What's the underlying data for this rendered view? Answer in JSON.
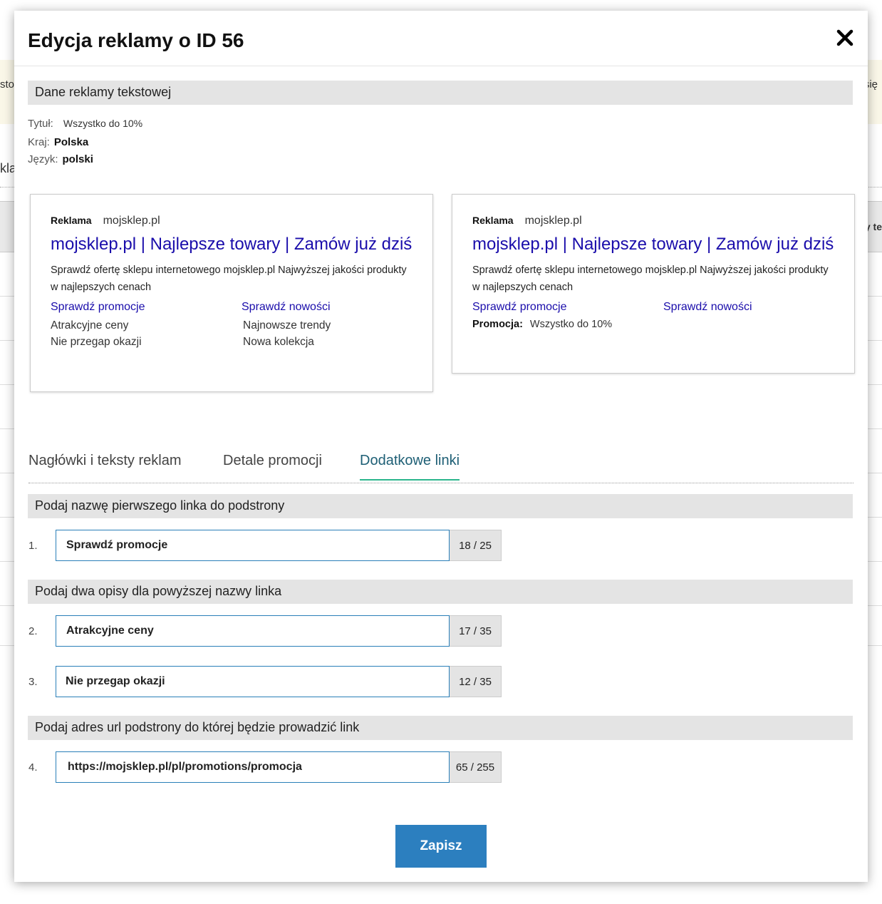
{
  "background": {
    "fragment_left_top": "sto",
    "fragment_right_top": "się",
    "fragment_left_mid": "kla",
    "fragment_right_header": "y te"
  },
  "modal": {
    "title": "Edycja reklamy o ID 56",
    "close_icon": "close-icon"
  },
  "ad_data": {
    "section_title": "Dane reklamy tekstowej",
    "title_label": "Tytuł:",
    "title_value": "Wszystko do 10%",
    "country_label": "Kraj:",
    "country_value": "Polska",
    "language_label": "Język:",
    "language_value": "polski"
  },
  "previews": [
    {
      "badge": "Reklama",
      "domain": "mojsklep.pl",
      "headline": "mojsklep.pl | Najlepsze towary  | Zamów już dziś",
      "description": "Sprawdź ofertę sklepu internetowego mojsklep.pl  Najwyższej jakości produkty w najlepszych cenach",
      "link_a": "Sprawdź promocje",
      "link_b": "Sprawdź nowości",
      "link_a_desc1": "Atrakcyjne ceny",
      "link_a_desc2": "Nie przegap okazji",
      "link_b_desc1": "Najnowsze trendy",
      "link_b_desc2": "Nowa kolekcja"
    },
    {
      "badge": "Reklama",
      "domain": "mojsklep.pl",
      "headline": "mojsklep.pl | Najlepsze towary  | Zamów już dziś",
      "description": "Sprawdź ofertę sklepu internetowego mojsklep.pl  Najwyższej jakości produkty w najlepszych cenach",
      "link_a": "Sprawdź promocje",
      "link_b": "Sprawdź nowości",
      "promo_label": "Promocja:",
      "promo_value": "Wszystko do 10%"
    }
  ],
  "tabs": [
    {
      "label": "Nagłówki i teksty reklam",
      "active": false
    },
    {
      "label": "Detale promocji",
      "active": false
    },
    {
      "label": "Dodatkowe linki",
      "active": true
    }
  ],
  "form": {
    "section1": "Podaj nazwę pierwszego linka do podstrony",
    "section2": "Podaj dwa opisy dla powyższej nazwy linka",
    "section3": "Podaj adres url podstrony do której będzie prowadzić link",
    "fields": [
      {
        "num": "1.",
        "value": "Sprawdź promocje",
        "counter": "18 / 25"
      },
      {
        "num": "2.",
        "value": "Atrakcyjne ceny",
        "counter": "17 / 35"
      },
      {
        "num": "3.",
        "value": "Nie przegap okazji",
        "counter": "12 / 35"
      },
      {
        "num": "4.",
        "value": "https://mojsklep.pl/pl/promotions/promocja",
        "counter": "65 / 255"
      }
    ]
  },
  "actions": {
    "save_label": "Zapisz"
  },
  "colors": {
    "accent": "#2c7fbf",
    "tab_active": "#1e5f75",
    "tab_underline": "#2bb58c",
    "ad_link": "#1a0dab"
  }
}
